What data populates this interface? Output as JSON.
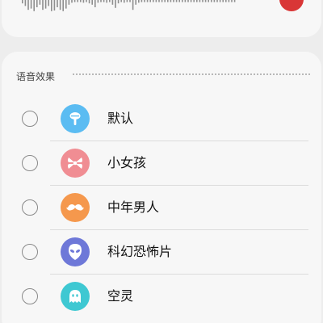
{
  "recorder": {
    "state": "recording"
  },
  "section": {
    "title": "语音效果"
  },
  "effects": [
    {
      "label": "默认",
      "icon": "microphone-icon",
      "color": "#5bbcf2"
    },
    {
      "label": "小女孩",
      "icon": "bow-icon",
      "color": "#f08d93"
    },
    {
      "label": "中年男人",
      "icon": "mustache-icon",
      "color": "#f5984d"
    },
    {
      "label": "科幻恐怖片",
      "icon": "alien-icon",
      "color": "#6e78d8"
    },
    {
      "label": "空灵",
      "icon": "ghost-icon",
      "color": "#3ec8d2"
    }
  ],
  "colors": {
    "record": "#d93636"
  }
}
